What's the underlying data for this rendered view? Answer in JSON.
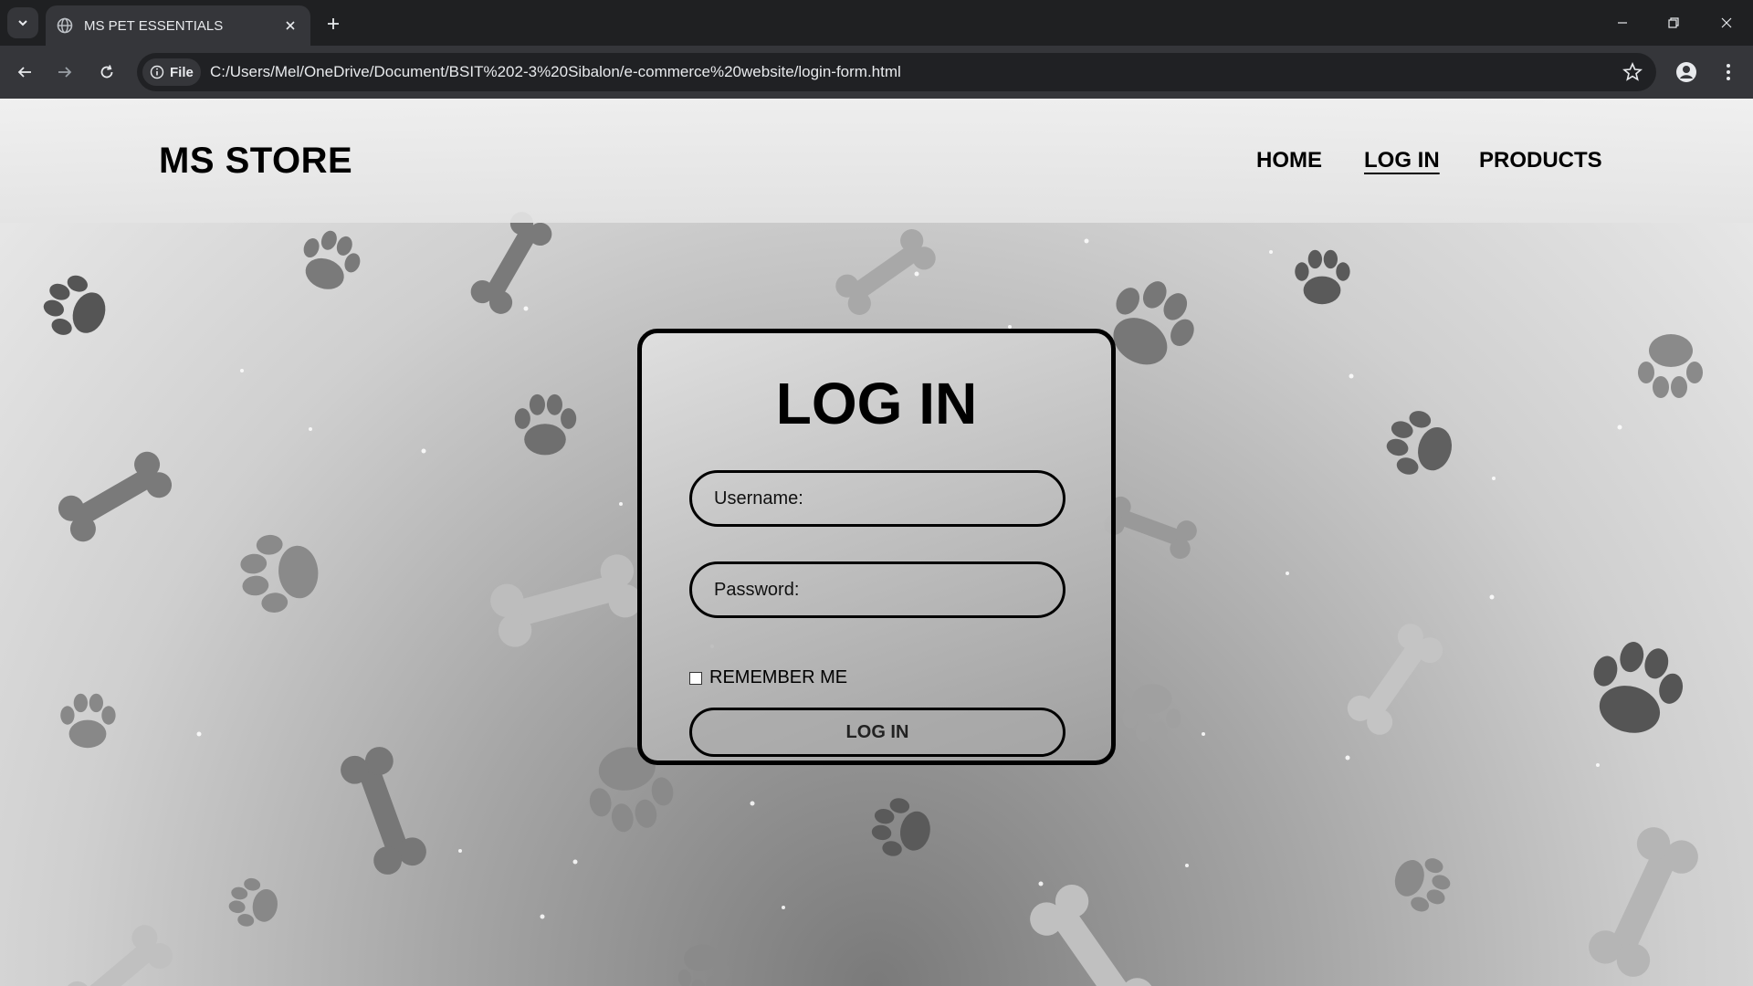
{
  "browser": {
    "tab_title": "MS PET ESSENTIALS",
    "chip_label": "File",
    "url": "C:/Users/Mel/OneDrive/Document/BSIT%202-3%20Sibalon/e-commerce%20website/login-form.html",
    "icons": [
      "tab-dropdown-icon",
      "globe-icon",
      "close-icon",
      "plus-icon",
      "minimize-icon",
      "restore-icon",
      "window-close-icon",
      "back-icon",
      "forward-icon",
      "reload-icon",
      "info-icon",
      "star-icon",
      "profile-icon",
      "kebab-icon"
    ]
  },
  "header": {
    "brand": "MS STORE",
    "nav": [
      {
        "label": "HOME",
        "active": false
      },
      {
        "label": "LOG IN",
        "active": true
      },
      {
        "label": "PRODUCTS",
        "active": false
      }
    ]
  },
  "login": {
    "title": "LOG IN",
    "username_placeholder": "Username:",
    "password_placeholder": "Password:",
    "remember_label": "REMEMBER ME",
    "remember_checked": false,
    "button_label": "LOG IN"
  },
  "background": {
    "decorations": [
      "paw-print-icon",
      "bone-icon"
    ]
  }
}
